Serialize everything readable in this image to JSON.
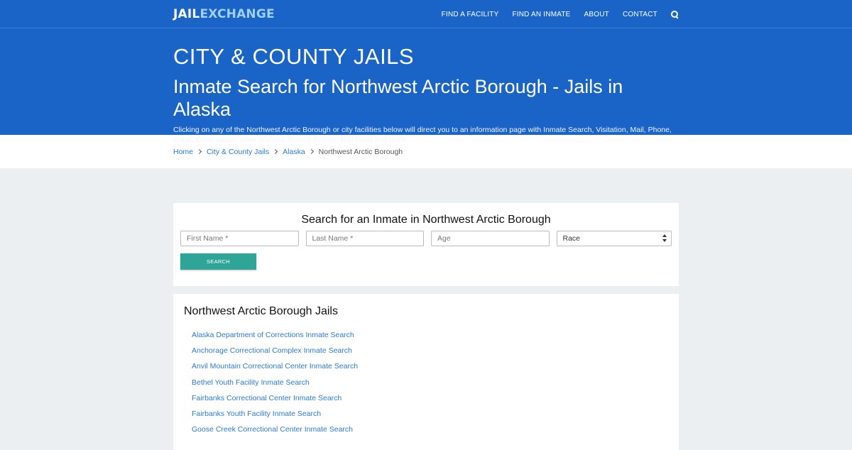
{
  "header": {
    "logo_part1": "JAIL",
    "logo_part2": "EXCHANGE",
    "nav": [
      "FIND A FACILITY",
      "FIND AN INMATE",
      "ABOUT",
      "CONTACT"
    ]
  },
  "hero": {
    "title": "CITY & COUNTY JAILS",
    "subtitle": "Inmate Search for Northwest Arctic Borough - Jails in Alaska",
    "description": "Clicking on any of the Northwest Arctic Borough or city facilities below will direct you to an information page with Inmate Search, Visitation, Mail, Phone, Email, Court cases, Most Wanted, Recent Arrests, Bail/Bond and more."
  },
  "breadcrumb": {
    "items": [
      "Home",
      "City & County Jails",
      "Alaska"
    ],
    "current": "Northwest Arctic Borough"
  },
  "search": {
    "heading": "Search for an Inmate in Northwest Arctic Borough",
    "first_name_placeholder": "First Name *",
    "last_name_placeholder": "Last Name *",
    "age_placeholder": "Age",
    "race_selected": "Race",
    "button_label": "SEARCH"
  },
  "jails": {
    "heading": "Northwest Arctic Borough Jails",
    "items": [
      "Alaska Department of Corrections Inmate Search",
      "Anchorage Correctional Complex Inmate Search",
      "Anvil Mountain Correctional Center Inmate Search",
      "Bethel Youth Facility Inmate Search",
      "Fairbanks Correctional Center Inmate Search",
      "Fairbanks Youth Facility Inmate Search",
      "Goose Creek Correctional Center Inmate Search"
    ]
  },
  "colors": {
    "brand_blue": "#1a64c8",
    "link_blue": "#2b79d4",
    "button_teal": "#2fa597",
    "page_bg": "#eceff2"
  }
}
